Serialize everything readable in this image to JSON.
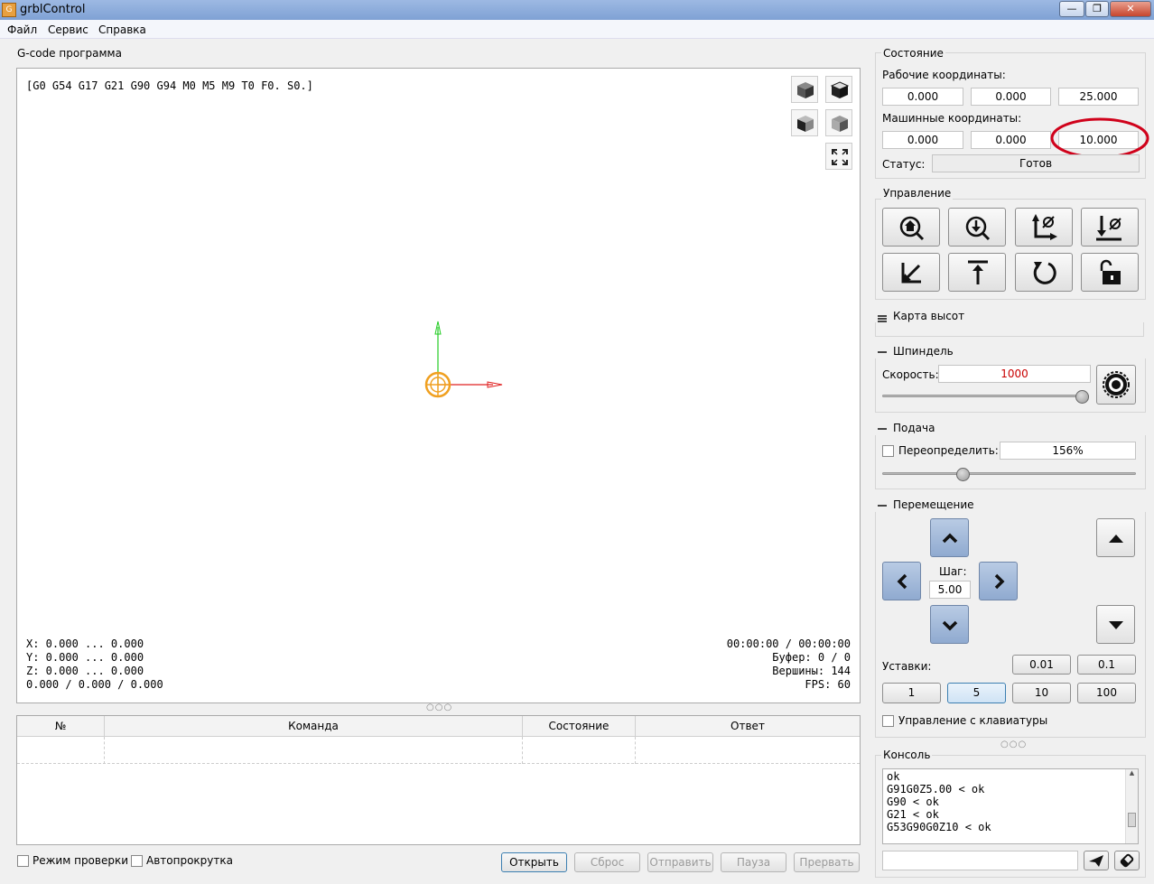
{
  "window": {
    "title": "grblControl",
    "icon_label": "G"
  },
  "menu": {
    "items": [
      "Файл",
      "Сервис",
      "Справка"
    ]
  },
  "gcode": {
    "group_title": "G-code программа",
    "state_line": "[G0 G54 G17 G21 G90 G94 M0 M5 M9 T0 F0. S0.]",
    "bounds": {
      "x": "X: 0.000 ... 0.000",
      "y": "Y: 0.000 ... 0.000",
      "z": "Z: 0.000 ... 0.000",
      "pos": "0.000 / 0.000 / 0.000"
    },
    "stats": {
      "time": "00:00:00 / 00:00:00",
      "buffer": "Буфер: 0 / 0",
      "vertices": "Вершины: 144",
      "fps": "FPS: 60"
    }
  },
  "table": {
    "headers": [
      "№",
      "Команда",
      "Состояние",
      "Ответ"
    ]
  },
  "bottom": {
    "check_mode": "Режим проверки",
    "autoscroll": "Автопрокрутка",
    "buttons": [
      "Открыть",
      "Сброс",
      "Отправить",
      "Пауза",
      "Прервать"
    ]
  },
  "state": {
    "group_title": "Состояние",
    "work_label": "Рабочие координаты:",
    "work": [
      "0.000",
      "0.000",
      "25.000"
    ],
    "machine_label": "Машинные координаты:",
    "machine": [
      "0.000",
      "0.000",
      "10.000"
    ],
    "status_label": "Статус:",
    "status_value": "Готов",
    "highlight_color": "#d0021b"
  },
  "control": {
    "group_title": "Управление"
  },
  "heightmap": {
    "title": "Карта высот"
  },
  "spindle": {
    "title": "Шпиндель",
    "speed_label": "Скорость:",
    "speed_value": "1000",
    "speed_color": "#c80000",
    "slider_fraction": 1.0
  },
  "feed": {
    "title": "Подача",
    "override_label": "Переопределить:",
    "override_value": "156%",
    "slider_fraction": 0.31
  },
  "jog": {
    "title": "Перемещение",
    "step_label": "Шаг:",
    "step_value": "5.00",
    "presets_label": "Уставки:",
    "presets_row1": [
      "0.01",
      "0.1"
    ],
    "presets_row2": [
      "1",
      "5",
      "10",
      "100"
    ],
    "keyboard_label": "Управление с клавиатуры"
  },
  "console": {
    "title": "Консоль",
    "lines": [
      "ok",
      "G91G0Z5.00 < ok",
      "G90 < ok",
      "G21 < ok",
      "G53G90G0Z10 < ok"
    ]
  }
}
